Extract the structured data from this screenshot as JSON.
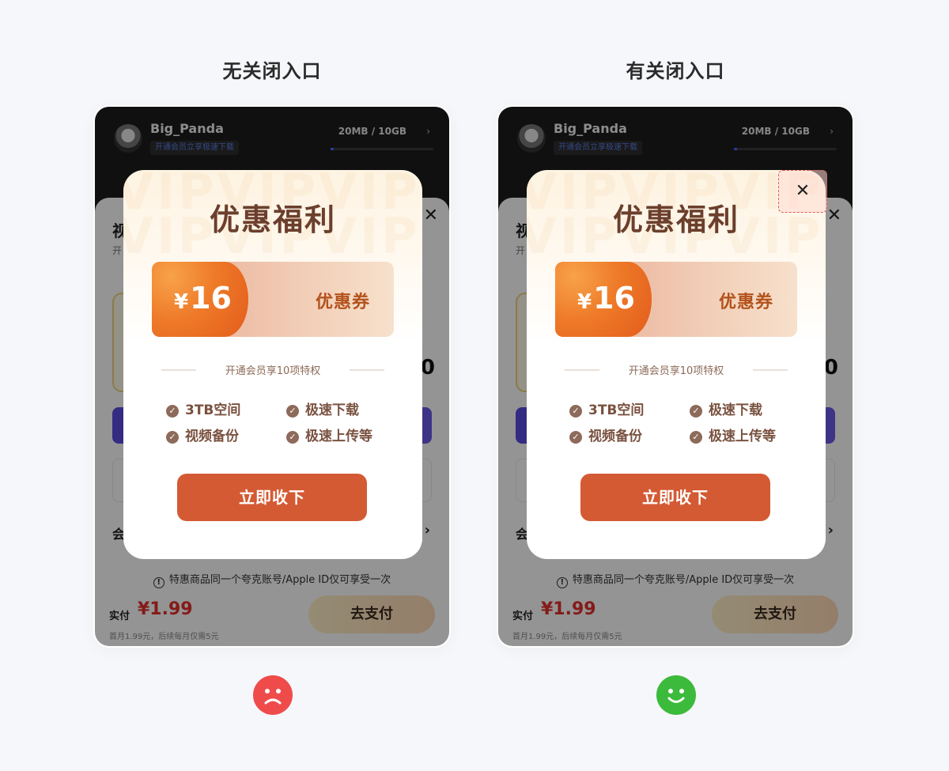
{
  "left": {
    "title": "无关闭入口"
  },
  "right": {
    "title": "有关闭入口"
  },
  "app": {
    "user_name": "Big_Panda",
    "vip_banner": "开通会员立享极速下载",
    "storage": "20MB / 10GB",
    "sheet_title": "视",
    "sheet_sub": "开",
    "sheet_price_tail": "0",
    "sheet_section": "会",
    "notice": "特惠商品同一个夸克账号/Apple ID仅可享受一次",
    "pay_label": "实付",
    "pay_price": "¥1.99",
    "pay_note": "首月1.99元，后续每月仅需5元",
    "pay_button": "去支付"
  },
  "modal": {
    "watermark": "VIPVIPVIP",
    "title": "优惠福利",
    "coupon_amount": "16",
    "coupon_currency": "¥",
    "coupon_label": "优惠券",
    "perk_heading": "开通会员享10项特权",
    "perks": [
      "3TB空间",
      "极速下载",
      "视频备份",
      "极速上传等"
    ],
    "claim_button": "立即收下",
    "close_symbol": "✕"
  },
  "colors": {
    "bad_face": "#ef4b4b",
    "good_face": "#3cba3c",
    "claim_button": "#d45a34",
    "close_highlight": "#e05a56"
  },
  "icons": {
    "bad": "sad-face-icon",
    "good": "smile-face-icon"
  }
}
